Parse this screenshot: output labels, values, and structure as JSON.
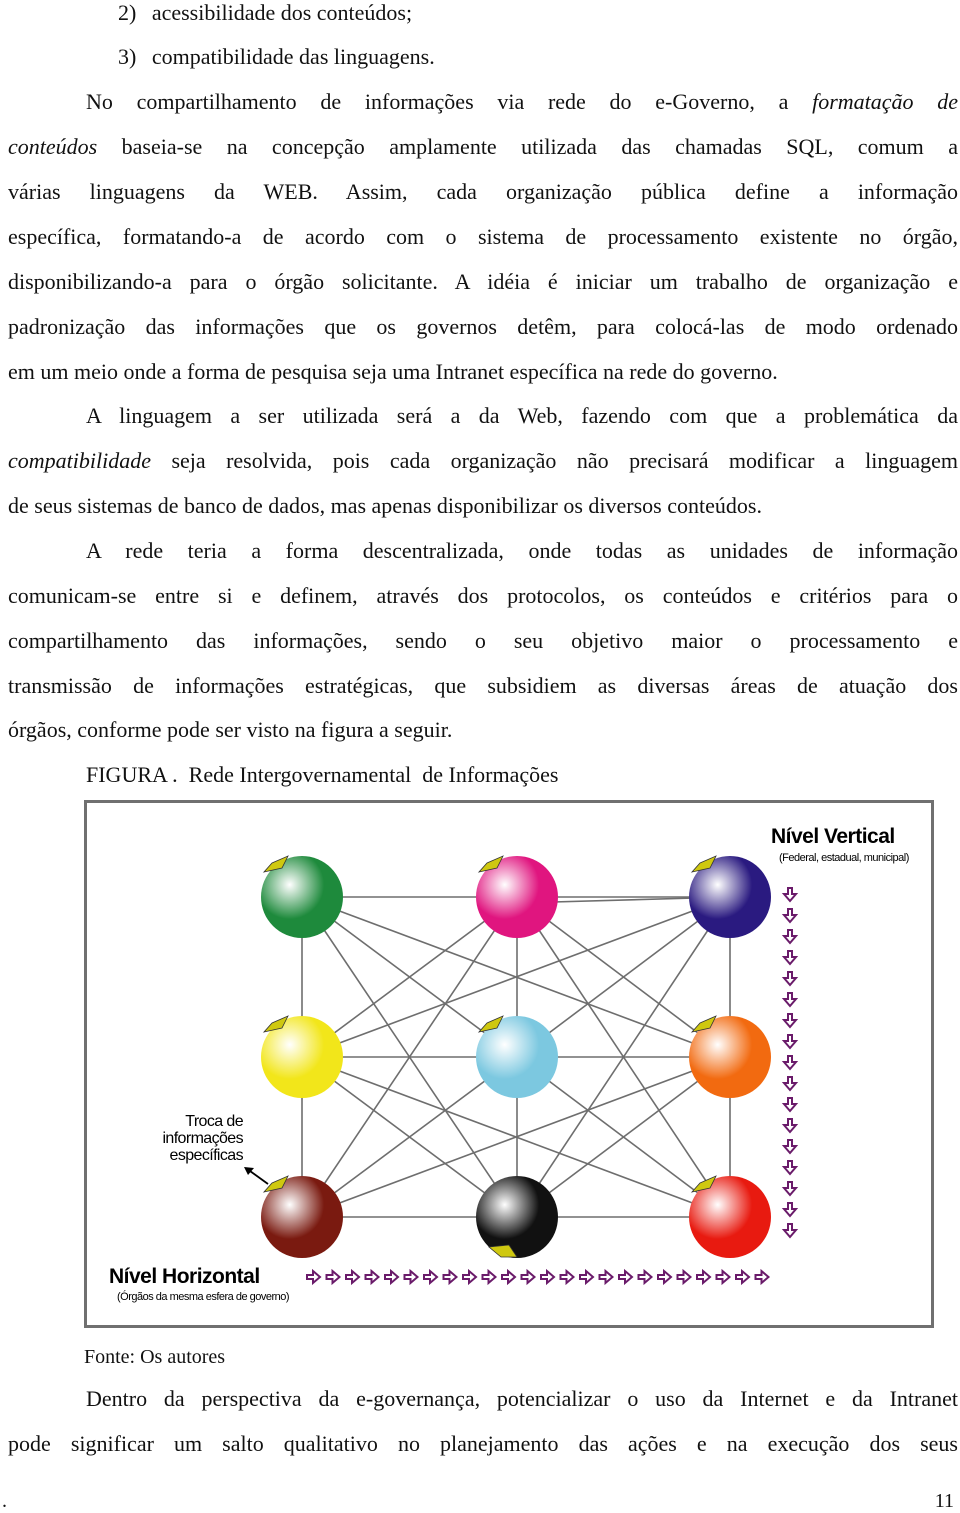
{
  "list_items": [
    {
      "num": "2)",
      "text": "acessibilidade dos conteúdos;"
    },
    {
      "num": "3)",
      "text": "compatibilidade das linguagens."
    }
  ],
  "paragraph1": {
    "line1_a": "No compartilhamento de informações via rede do e-Governo, a ",
    "line1_italic": "formatação de",
    "line2_italic": "conteúdos",
    "line2_b": " baseia-se na concepção amplamente utilizada das chamadas SQL, comum a",
    "line3": "várias linguagens da WEB. Assim, cada organização pública define a informação",
    "line4": "específica, formatando-a de acordo com o sistema de processamento existente no órgão,",
    "line5": "disponibilizando-a para o órgão solicitante. A idéia é iniciar um trabalho de organização e",
    "line6": "padronização das informações que os governos detêm, para colocá-las de modo ordenado",
    "line7": "em um meio onde a forma de pesquisa seja uma Intranet específica na rede do governo."
  },
  "paragraph2": {
    "line1": "A linguagem a ser utilizada será a da Web, fazendo com que a problemática da",
    "line2_italic": "compatibilidade",
    "line2_b": " seja resolvida, pois cada organização não precisará modificar a linguagem",
    "line3": "de seus sistemas de banco de dados, mas apenas disponibilizar os diversos conteúdos."
  },
  "paragraph3": {
    "line1": "A rede teria a forma descentralizada, onde todas as unidades de informação",
    "line2": "comunicam-se entre si e definem, através dos protocolos, os conteúdos e critérios para o",
    "line3": "compartilhamento das informações, sendo o seu objetivo maior o processamento e",
    "line4": "transmissão de informações estratégicas, que subsidiem as diversas áreas de atuação dos",
    "line5": "órgãos, conforme pode ser visto na figura a seguir."
  },
  "figure": {
    "caption": "FIGURA .  Rede Intergovernamental  de Informações",
    "vertical_title": "Nível Vertical",
    "vertical_subtitle": "(Federal, estadual, municipal)",
    "horizontal_title": "Nível Horizontal",
    "horizontal_subtitle": "(Órgãos da mesma esfera de governo)",
    "annotation": [
      "Troca de",
      "informações",
      "específicas"
    ],
    "arrow_color": "#6a1b6a",
    "down_arrow_count": 17,
    "right_arrow_count": 24,
    "nodes": [
      {
        "id": "green",
        "row": 0,
        "col": 0,
        "color": "#1e8a3c"
      },
      {
        "id": "pink",
        "row": 0,
        "col": 1,
        "color": "#e0157f"
      },
      {
        "id": "purple",
        "row": 0,
        "col": 2,
        "color": "#2a1a80"
      },
      {
        "id": "yellow",
        "row": 1,
        "col": 0,
        "color": "#f2e61a"
      },
      {
        "id": "cyan",
        "row": 1,
        "col": 1,
        "color": "#7cc8e0"
      },
      {
        "id": "orange",
        "row": 1,
        "col": 2,
        "color": "#f26a10"
      },
      {
        "id": "brown",
        "row": 2,
        "col": 0,
        "color": "#7a1a10"
      },
      {
        "id": "black",
        "row": 2,
        "col": 1,
        "color": "#111111"
      },
      {
        "id": "red",
        "row": 2,
        "col": 2,
        "color": "#e81a10"
      }
    ],
    "edges": [
      [
        "green",
        "pink"
      ],
      [
        "pink",
        "purple"
      ],
      [
        "yellow",
        "cyan"
      ],
      [
        "cyan",
        "orange"
      ],
      [
        "brown",
        "black"
      ],
      [
        "black",
        "red"
      ],
      [
        "green",
        "yellow"
      ],
      [
        "yellow",
        "brown"
      ],
      [
        "pink",
        "cyan"
      ],
      [
        "cyan",
        "black"
      ],
      [
        "purple",
        "orange"
      ],
      [
        "orange",
        "red"
      ],
      [
        "green",
        "cyan"
      ],
      [
        "green",
        "orange"
      ],
      [
        "green",
        "black"
      ],
      [
        "pink",
        "yellow"
      ],
      [
        "pink",
        "brown"
      ],
      [
        "pink",
        "orange"
      ],
      [
        "pink",
        "red"
      ],
      [
        "purple",
        "yellow"
      ],
      [
        "purple",
        "cyan"
      ],
      [
        "purple",
        "black"
      ],
      [
        "yellow",
        "black"
      ],
      [
        "yellow",
        "red"
      ],
      [
        "cyan",
        "brown"
      ],
      [
        "cyan",
        "red"
      ],
      [
        "orange",
        "brown"
      ],
      [
        "orange",
        "black"
      ],
      [
        "pink",
        "purple"
      ]
    ],
    "source": "Fonte: Os autores"
  },
  "paragraph4": {
    "line1": "Dentro da perspectiva da e-governança, potencializar o uso da Internet e da Intranet",
    "line2": "pode significar um salto qualitativo no planejamento das ações e na execução dos seus"
  },
  "footer": {
    "dot": ".",
    "page_number": "11"
  }
}
